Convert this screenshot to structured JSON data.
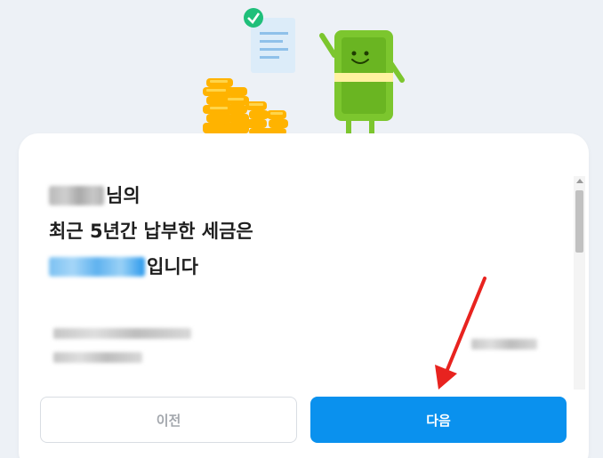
{
  "illustration": {
    "icons": [
      "check-badge-icon",
      "document-icon",
      "gold-coins-icon",
      "money-character-icon"
    ]
  },
  "headline": {
    "name_suffix": "님의",
    "line2": "최근 5년간 납부한 세금은",
    "amount_suffix": "입니다"
  },
  "buttons": {
    "prev_label": "이전",
    "next_label": "다음"
  },
  "colors": {
    "accent": "#0a91ee",
    "arrow": "#e8231f",
    "background": "#edf1f6"
  }
}
